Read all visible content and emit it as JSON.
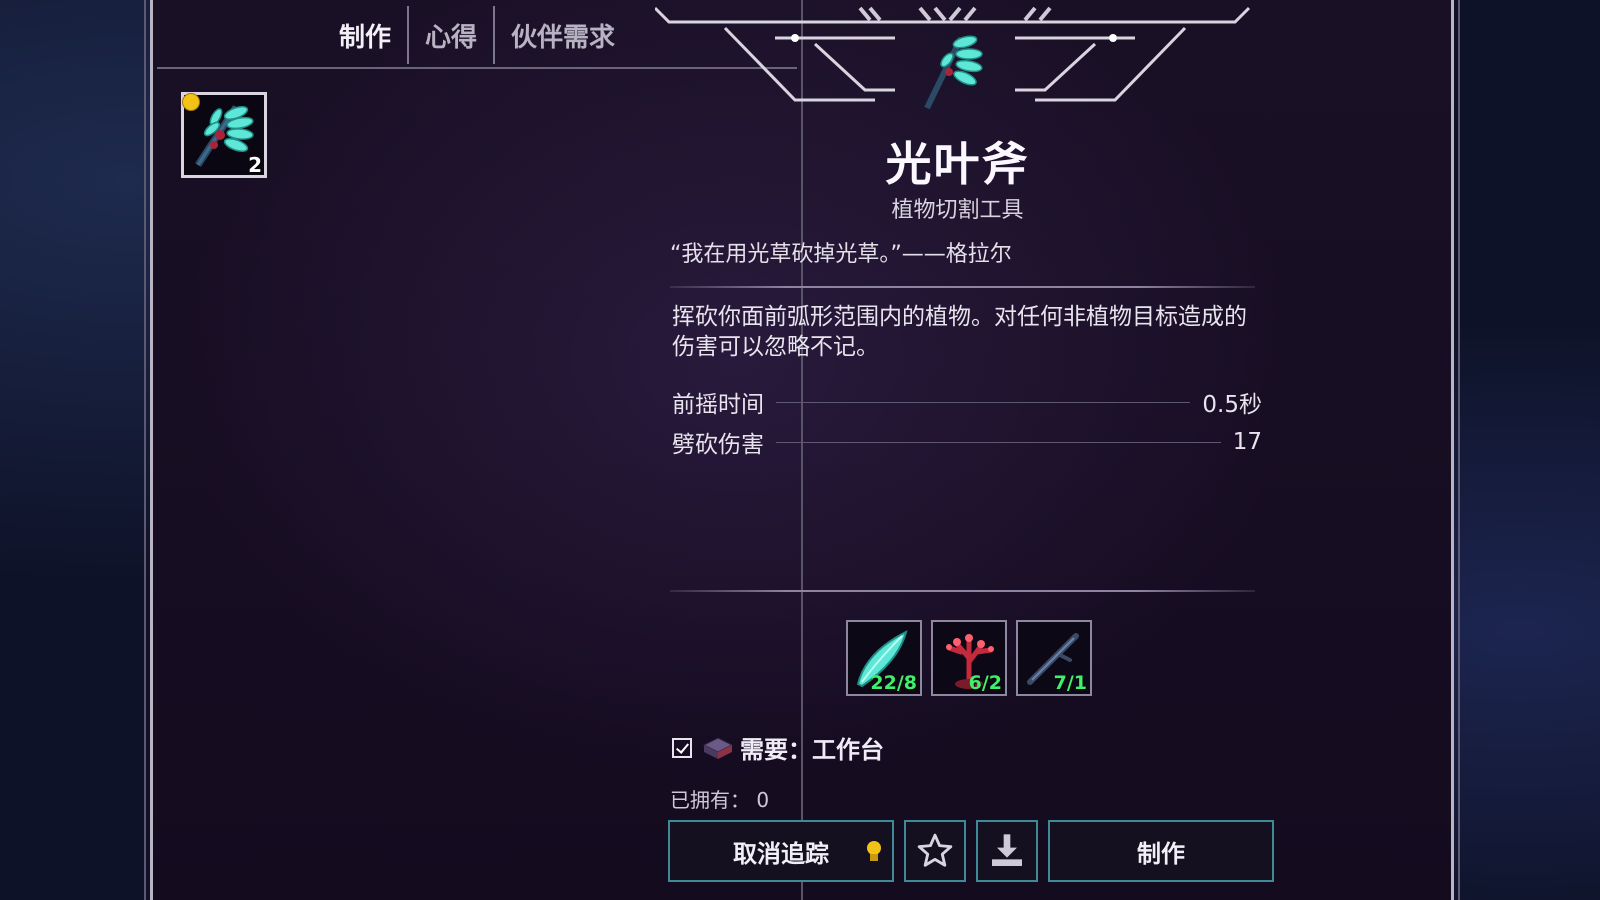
{
  "tabs": [
    {
      "label": "制作",
      "active": true
    },
    {
      "label": "心得",
      "active": false
    },
    {
      "label": "伙伴需求",
      "active": false
    }
  ],
  "recipe_list": [
    {
      "icon": "glow-leaf-axe-icon",
      "count": "2",
      "tracked": true
    }
  ],
  "item": {
    "name": "光叶斧",
    "type": "植物切割工具",
    "quote": "“我在用光草砍掉光草。”——格拉尔",
    "description": "挥砍你面前弧形范围内的植物。对任何非植物目标造成的伤害可以忽略不记。",
    "stats": [
      {
        "label": "前摇时间",
        "value": "0.5秒"
      },
      {
        "label": "劈砍伤害",
        "value": "17"
      }
    ]
  },
  "ingredients": [
    {
      "icon": "glowing-leaf-icon",
      "qty": "22/8"
    },
    {
      "icon": "red-coral-icon",
      "qty": "6/2"
    },
    {
      "icon": "wooden-stick-icon",
      "qty": "7/1"
    }
  ],
  "requirement": {
    "label": "需要：工作台",
    "met": true
  },
  "owned": "已拥有： 0",
  "buttons": {
    "untrack": "取消追踪",
    "craft": "制作"
  },
  "colors": {
    "accent_teal": "#3e8a96",
    "ingredient_ok": "#3ef06a",
    "track_bulb": "#f2c316"
  }
}
